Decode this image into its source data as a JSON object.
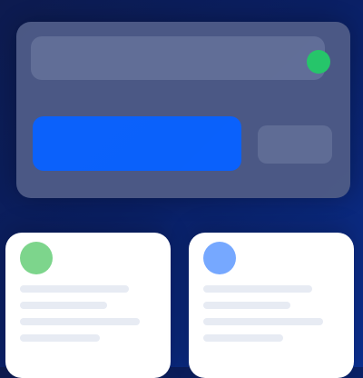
{
  "colors": {
    "status": "#27c96b",
    "primary": "#0b63ff",
    "left_card_accent": "#7dd58c",
    "right_card_accent": "#76a8ff"
  },
  "icons": {
    "status": "status-dot-icon",
    "left_card": "card-accent-icon",
    "right_card": "card-accent-icon"
  }
}
